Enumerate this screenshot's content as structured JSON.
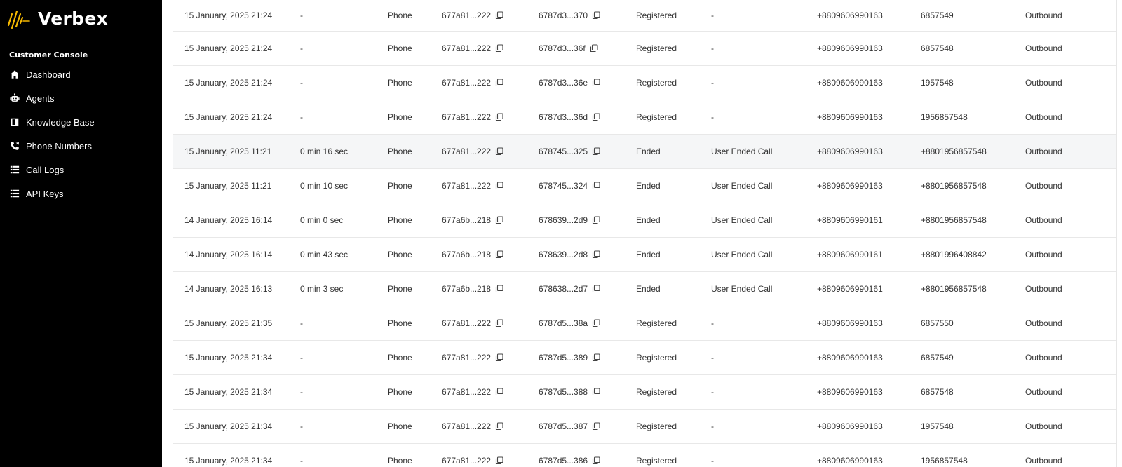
{
  "brand": {
    "name": "Verbex"
  },
  "sidebar": {
    "section_label": "Customer Console",
    "items": [
      {
        "label": "Dashboard",
        "icon": "home-icon"
      },
      {
        "label": "Agents",
        "icon": "robot-icon"
      },
      {
        "label": "Knowledge Base",
        "icon": "book-icon"
      },
      {
        "label": "Phone Numbers",
        "icon": "phone-icon"
      },
      {
        "label": "Call Logs",
        "icon": "list-icon"
      },
      {
        "label": "API Keys",
        "icon": "list-icon"
      }
    ]
  },
  "calls": [
    {
      "date": "15 January, 2025 21:24",
      "duration": "-",
      "type": "Phone",
      "agent_id": "677a81...222",
      "call_id": "6787d3...370",
      "status": "Registered",
      "end_reason": "-",
      "from": "+8809606990163",
      "to": "6857549",
      "direction": "Outbound"
    },
    {
      "date": "15 January, 2025 21:24",
      "duration": "-",
      "type": "Phone",
      "agent_id": "677a81...222",
      "call_id": "6787d3...36f",
      "status": "Registered",
      "end_reason": "-",
      "from": "+8809606990163",
      "to": "6857548",
      "direction": "Outbound"
    },
    {
      "date": "15 January, 2025 21:24",
      "duration": "-",
      "type": "Phone",
      "agent_id": "677a81...222",
      "call_id": "6787d3...36e",
      "status": "Registered",
      "end_reason": "-",
      "from": "+8809606990163",
      "to": "1957548",
      "direction": "Outbound"
    },
    {
      "date": "15 January, 2025 21:24",
      "duration": "-",
      "type": "Phone",
      "agent_id": "677a81...222",
      "call_id": "6787d3...36d",
      "status": "Registered",
      "end_reason": "-",
      "from": "+8809606990163",
      "to": "1956857548",
      "direction": "Outbound"
    },
    {
      "date": "15 January, 2025 11:21",
      "duration": "0 min 16 sec",
      "type": "Phone",
      "agent_id": "677a81...222",
      "call_id": "678745...325",
      "status": "Ended",
      "end_reason": "User Ended Call",
      "from": "+8809606990163",
      "to": "+8801956857548",
      "direction": "Outbound"
    },
    {
      "date": "15 January, 2025 11:21",
      "duration": "0 min 10 sec",
      "type": "Phone",
      "agent_id": "677a81...222",
      "call_id": "678745...324",
      "status": "Ended",
      "end_reason": "User Ended Call",
      "from": "+8809606990163",
      "to": "+8801956857548",
      "direction": "Outbound"
    },
    {
      "date": "14 January, 2025 16:14",
      "duration": "0 min 0 sec",
      "type": "Phone",
      "agent_id": "677a6b...218",
      "call_id": "678639...2d9",
      "status": "Ended",
      "end_reason": "User Ended Call",
      "from": "+8809606990161",
      "to": "+8801956857548",
      "direction": "Outbound"
    },
    {
      "date": "14 January, 2025 16:14",
      "duration": "0 min 43 sec",
      "type": "Phone",
      "agent_id": "677a6b...218",
      "call_id": "678639...2d8",
      "status": "Ended",
      "end_reason": "User Ended Call",
      "from": "+8809606990161",
      "to": "+8801996408842",
      "direction": "Outbound"
    },
    {
      "date": "14 January, 2025 16:13",
      "duration": "0 min 3 sec",
      "type": "Phone",
      "agent_id": "677a6b...218",
      "call_id": "678638...2d7",
      "status": "Ended",
      "end_reason": "User Ended Call",
      "from": "+8809606990161",
      "to": "+8801956857548",
      "direction": "Outbound"
    },
    {
      "date": "15 January, 2025 21:35",
      "duration": "-",
      "type": "Phone",
      "agent_id": "677a81...222",
      "call_id": "6787d5...38a",
      "status": "Registered",
      "end_reason": "-",
      "from": "+8809606990163",
      "to": "6857550",
      "direction": "Outbound"
    },
    {
      "date": "15 January, 2025 21:34",
      "duration": "-",
      "type": "Phone",
      "agent_id": "677a81...222",
      "call_id": "6787d5...389",
      "status": "Registered",
      "end_reason": "-",
      "from": "+8809606990163",
      "to": "6857549",
      "direction": "Outbound"
    },
    {
      "date": "15 January, 2025 21:34",
      "duration": "-",
      "type": "Phone",
      "agent_id": "677a81...222",
      "call_id": "6787d5...388",
      "status": "Registered",
      "end_reason": "-",
      "from": "+8809606990163",
      "to": "6857548",
      "direction": "Outbound"
    },
    {
      "date": "15 January, 2025 21:34",
      "duration": "-",
      "type": "Phone",
      "agent_id": "677a81...222",
      "call_id": "6787d5...387",
      "status": "Registered",
      "end_reason": "-",
      "from": "+8809606990163",
      "to": "1957548",
      "direction": "Outbound"
    },
    {
      "date": "15 January, 2025 21:34",
      "duration": "-",
      "type": "Phone",
      "agent_id": "677a81...222",
      "call_id": "6787d5...386",
      "status": "Registered",
      "end_reason": "-",
      "from": "+8809606990163",
      "to": "1956857548",
      "direction": "Outbound"
    }
  ],
  "highlighted_row": 4,
  "colors": {
    "sidebar_bg": "#000000",
    "logo_accent": "#f5b800",
    "row_highlight": "#f5f6f7"
  }
}
